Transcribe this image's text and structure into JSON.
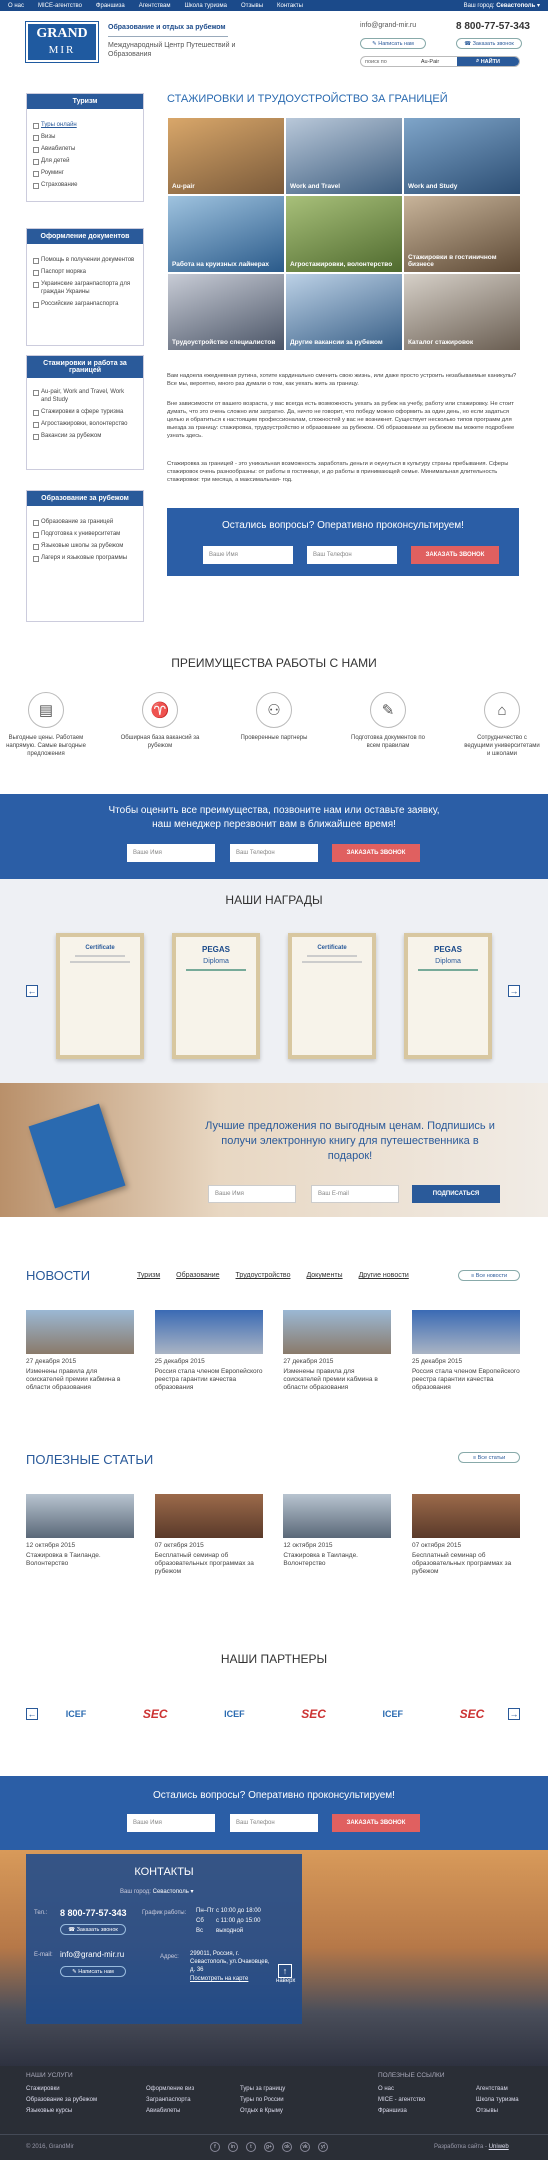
{
  "topbar": {
    "nav": [
      "О нас",
      "MICE-агентство",
      "Франшиза",
      "Агентствам",
      "Школа туризма",
      "Отзывы",
      "Контакты"
    ],
    "city_label": "Ваш город:",
    "city": "Севастополь"
  },
  "header": {
    "logo_top": "GRAND",
    "logo_bottom": "MIR",
    "tagline": "Образование и отдых за рубежом",
    "org": "Международный Центр Путешествий и Образования",
    "email": "info@grand-mir.ru",
    "phone": "8 800-77-57-343",
    "write_btn": "Написать нам",
    "call_btn": "Заказать звонок",
    "search_label": "поиск по",
    "search_scope": "Au-Pair",
    "search_btn": "НАЙТИ"
  },
  "sidebar": [
    {
      "title": "Туризм",
      "items": [
        "Туры онлайн",
        "Визы",
        "Авиабилеты",
        "Для детей",
        "Роуминг",
        "Страхование"
      ]
    },
    {
      "title": "Оформление документов",
      "items": [
        "Помощь в получении документов",
        "Паспорт моряка",
        "Украинские загранпаспорта для граждан Украины",
        "Российские загранпаспорта"
      ]
    },
    {
      "title": "Стажировки и работа за границей",
      "items": [
        "Au-pair, Work and Travel, Work and Study",
        "Стажировки в сфере туризма",
        "Агростажировки, волонтерство",
        "Вакансии за рубежом"
      ]
    },
    {
      "title": "Образование за рубежом",
      "items": [
        "Образование за границей",
        "Подготовка к университетам",
        "Языковые школы за рубежом",
        "Лагеря и языковые программы"
      ]
    }
  ],
  "main": {
    "title": "СТАЖИРОВКИ И ТРУДОУСТРОЙСТВО ЗА ГРАНИЦЕЙ",
    "tiles": [
      "Au-pair",
      "Work and Travel",
      "Work and Study",
      "Работа на круизных лайнерах",
      "Агростажировки, волонтерство",
      "Стажировки в гостиничном бизнесе",
      "Трудоустройство специалистов",
      "Другие вакансии за рубежом",
      "Каталог стажировок"
    ],
    "paragraphs": [
      "Вам надоела ежедневная рутина, хотите кардинально сменить свою жизнь, или даже просто устроить незабываемые каникулы? Все мы, вероятно, много раз думали о том, как уехать жить за границу.",
      "Вне зависимости от вашего возраста, у вас всегда есть возможность уехать за рубеж на учебу, работу или стажировку. Не стоит думать, что это очень сложно или затратно. Да, ничто не говорит, что победу можно оформить за один день, но если задаться целью и обратиться к настоящим профессионалам, сложностей у вас не возникнет. Существует несколько типов программ для выезда за границу: стажировка, трудоустройство и образование за рубежом. Об образовании за рубежом вы можете подробнее узнать здесь.",
      "Стажировка за границей - это уникальная возможность заработать деньги и окунуться в культуру страны пребывания. Сферы стажировок очень разнообразны: от работы в гостинице, и до работы в принимающей семье. Минимальная длительность стажировки: три месяца, а максимальная- год."
    ]
  },
  "cta1": {
    "title": "Остались вопросы? Оперативно проконсультируем!",
    "name_ph": "Ваше Имя",
    "phone_ph": "Ваш Телефон",
    "btn": "ЗАКАЗАТЬ ЗВОНОК"
  },
  "advantages": {
    "title": "ПРЕИМУЩЕСТВА РАБОТЫ С НАМИ",
    "items": [
      "Выгодные цены. Работаем напрямую. Самые выгодные предложения",
      "Обширная база вакансий за рубежом",
      "Проверенные партнеры",
      "Подготовка документов по всем правилам",
      "Сотрудничество с ведущими университетами и школами"
    ]
  },
  "callband": {
    "text": "Чтобы оценить все преимущества, позвоните нам или оставьте заявку, наш менеджер перезвонит вам в ближайшее время!",
    "name_ph": "Ваше Имя",
    "phone_ph": "Ваш Телефон",
    "btn": "ЗАКАЗАТЬ ЗВОНОК"
  },
  "awards": {
    "title": "НАШИ НАГРАДЫ",
    "items": [
      "Certificate",
      "Diploma",
      "Certificate",
      "Diploma"
    ],
    "brand": "PEGAS"
  },
  "subscribe": {
    "text": "Лучшие предложения по выгодным ценам. Подпишись и получи электронную книгу для путешественника в подарок!",
    "name_ph": "Ваше Имя",
    "email_ph": "Ваш E-mail",
    "btn": "ПОДПИСАТЬСЯ"
  },
  "news": {
    "title": "НОВОСТИ",
    "tabs": [
      "Туризм",
      "Образование",
      "Трудоустройство",
      "Документы",
      "Другие новости"
    ],
    "all": "Все новости",
    "items": [
      {
        "date": "27 декабря 2015",
        "text": "Изменены правила для соискателей премии кабмина в области образования"
      },
      {
        "date": "25 декабря 2015",
        "text": "Россия стала членом Европейского реестра гарантии качества образования"
      },
      {
        "date": "27 декабря 2015",
        "text": "Изменены правила для соискателей премии кабмина в области образования"
      },
      {
        "date": "25 декабря 2015",
        "text": "Россия стала членом Европейского реестра гарантии качества образования"
      }
    ]
  },
  "articles": {
    "title": "ПОЛЕЗНЫЕ СТАТЬИ",
    "all": "Все статьи",
    "items": [
      {
        "date": "12 октября 2015",
        "text": "Стажировка в Таиланде. Волонтерство"
      },
      {
        "date": "07 октября 2015",
        "text": "Бесплатный семинар об образовательных программах за рубежом"
      },
      {
        "date": "12 октября 2015",
        "text": "Стажировка в Таиланде. Волонтерство"
      },
      {
        "date": "07 октября 2015",
        "text": "Бесплатный семинар об образовательных программах за рубежом"
      }
    ]
  },
  "partners": {
    "title": "НАШИ ПАРТНЕРЫ",
    "items": [
      "ICEF",
      "SEC",
      "ICEF",
      "SEC",
      "ICEF",
      "SEC"
    ]
  },
  "cta2": {
    "title": "Остались вопросы? Оперативно проконсультируем!",
    "name_ph": "Ваше Имя",
    "phone_ph": "Ваш Телефон",
    "btn": "ЗАКАЗАТЬ ЗВОНОК"
  },
  "contacts": {
    "title": "КОНТАКТЫ",
    "city_label": "Ваш город:",
    "city": "Севастополь",
    "tel_label": "Тел.:",
    "phone": "8 800-77-57-343",
    "call": "Заказать звонок",
    "email_label": "E-mail:",
    "email": "info@grand-mir.ru",
    "write": "Написать нам",
    "sched_label": "График работы:",
    "sched": [
      [
        "Пн–Пт",
        "с 10:00 до 18:00"
      ],
      [
        "Сб",
        "с 11:00 до 15:00"
      ],
      [
        "Вс",
        "выходной"
      ]
    ],
    "addr_label": "Адрес:",
    "addr": "299011, Россия, г. Севастополь, ул.Очаковцев, д. 36",
    "map": "Посмотреть на карте",
    "up": "наверх"
  },
  "footer": {
    "services_h": "НАШИ УСЛУГИ",
    "links_h": "ПОЛЕЗНЫЕ ССЫЛКИ",
    "c1": [
      "Стажировки",
      "Образование за рубежом",
      "Языковые курсы"
    ],
    "c2": [
      "Оформление виз",
      "Загранпаспорта",
      "Авиабилеты"
    ],
    "c3": [
      "Туры за границу",
      "Туры по России",
      "Отдых в Крыму"
    ],
    "c4": [
      "О нас",
      "MICE - агентство",
      "Франшиза"
    ],
    "c5": [
      "Агентствам",
      "Школа туризма",
      "Отзывы"
    ],
    "copy": "© 2016, GrandMir",
    "dev": "Разработка сайта -",
    "dev_name": "Uniweb",
    "social": [
      "f",
      "in",
      "t",
      "g+",
      "ok",
      "vk",
      "yt"
    ]
  },
  "colors": {
    "primary": "#2a5a9a",
    "dark": "#1b4a8a",
    "red": "#e06060",
    "footer": "#2a2e36"
  }
}
